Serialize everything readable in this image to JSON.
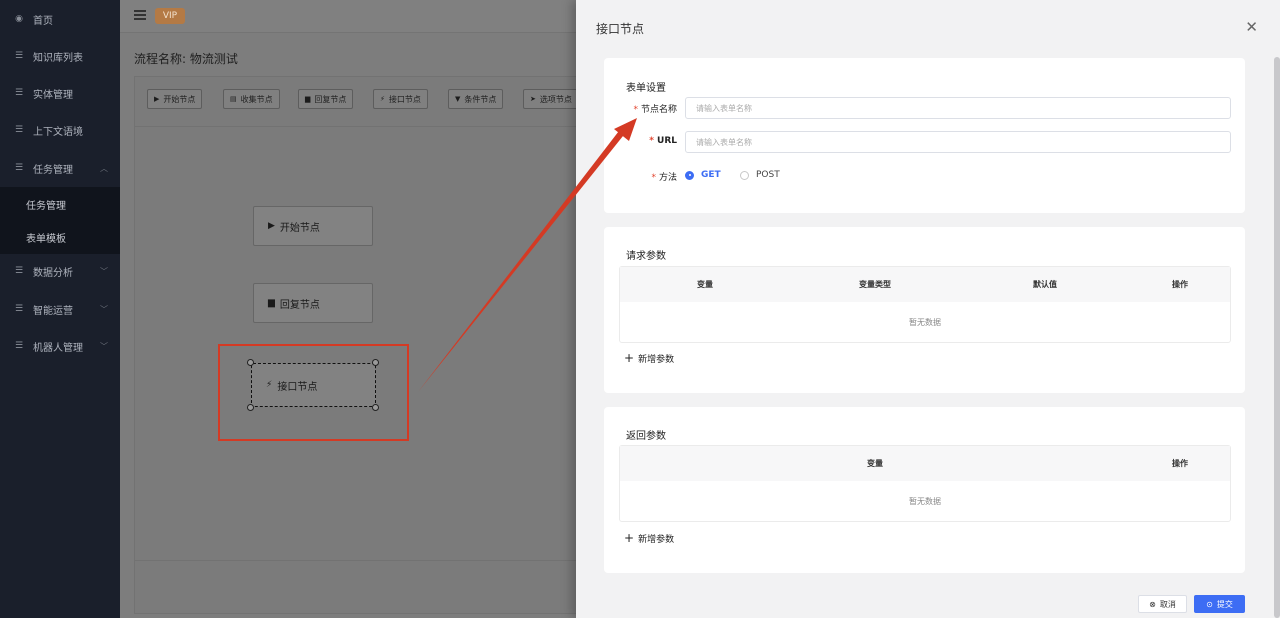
{
  "sidebar": {
    "items": [
      {
        "label": "首页",
        "icon": "dashboard-icon"
      },
      {
        "label": "知识库列表",
        "icon": "list-icon"
      },
      {
        "label": "实体管理",
        "icon": "list-icon"
      },
      {
        "label": "上下文语境",
        "icon": "list-icon"
      },
      {
        "label": "任务管理",
        "icon": "list-icon"
      },
      {
        "label": "数据分析",
        "icon": "list-icon"
      },
      {
        "label": "智能运营",
        "icon": "list-icon"
      },
      {
        "label": "机器人管理",
        "icon": "list-icon"
      }
    ],
    "sub_items": [
      {
        "label": "任务管理"
      },
      {
        "label": "表单模板"
      }
    ]
  },
  "header": {
    "vip_label": "VIP"
  },
  "main": {
    "flow_title": "流程名称: 物流测试",
    "toolbar": [
      {
        "label": "开始节点",
        "icon": "play-icon"
      },
      {
        "label": "收集节点",
        "icon": "doc-icon"
      },
      {
        "label": "回复节点",
        "icon": "message-icon"
      },
      {
        "label": "接口节点",
        "icon": "plug-icon"
      },
      {
        "label": "条件节点",
        "icon": "filter-icon"
      },
      {
        "label": "选项节点",
        "icon": "cursor-icon"
      }
    ],
    "nodes": [
      {
        "label": "开始节点",
        "icon": "play-icon"
      },
      {
        "label": "回复节点",
        "icon": "message-icon"
      },
      {
        "label": "接口节点",
        "icon": "plug-icon"
      }
    ]
  },
  "drawer": {
    "title": "接口节点",
    "form_section": {
      "title": "表单设置",
      "name_label": "节点名称",
      "name_placeholder": "请输入表单名称",
      "url_label": "URL",
      "url_placeholder": "请输入表单名称",
      "method_label": "方法",
      "methods": [
        {
          "label": "GET",
          "selected": true
        },
        {
          "label": "POST",
          "selected": false
        }
      ]
    },
    "request_section": {
      "title": "请求参数",
      "columns": [
        "变量",
        "变量类型",
        "默认值",
        "操作"
      ],
      "empty_text": "暂无数据",
      "add_label": "新增参数"
    },
    "response_section": {
      "title": "返回参数",
      "columns": [
        "变量",
        "操作"
      ],
      "empty_text": "暂无数据",
      "add_label": "新增参数"
    },
    "cancel_label": "取消",
    "submit_label": "提交"
  },
  "colors": {
    "primary": "#3d6df4",
    "annotation_red": "#d43a24",
    "vip": "#b47a45"
  }
}
